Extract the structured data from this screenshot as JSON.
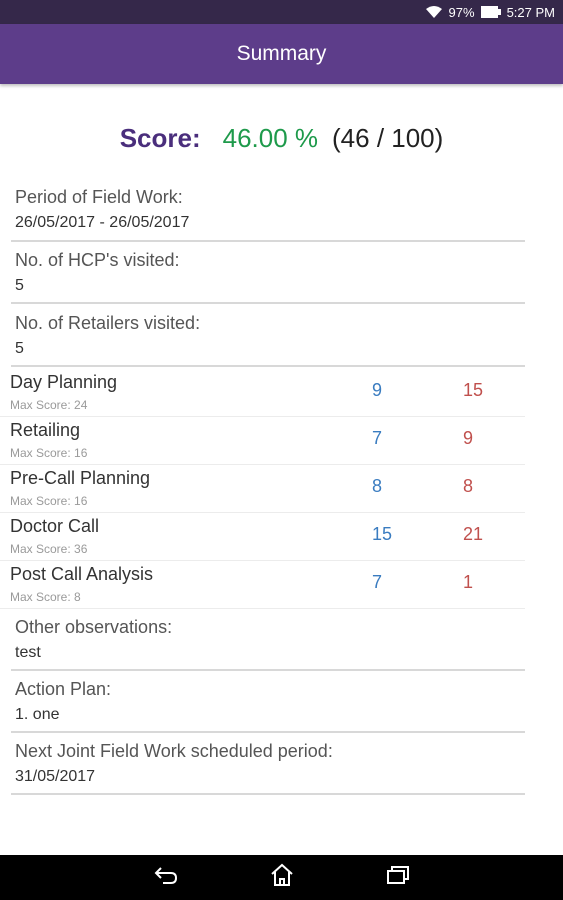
{
  "status_bar": {
    "battery_pct": "97%",
    "time": "5:27 PM",
    "icons": [
      "wifi-icon",
      "battery-icon"
    ]
  },
  "app_bar": {
    "title": "Summary"
  },
  "score": {
    "label": "Score:",
    "percent": "46.00 %",
    "ratio": "(46 / 100)"
  },
  "period": {
    "label": "Period of Field Work:",
    "value": "26/05/2017 - 26/05/2017"
  },
  "hcp": {
    "label": "No. of HCP's visited:",
    "value": "5"
  },
  "retailers": {
    "label": "No. of Retailers visited:",
    "value": "5"
  },
  "categories": [
    {
      "name": "Day Planning",
      "max": "Max Score: 24",
      "score": "9",
      "value": "15"
    },
    {
      "name": "Retailing",
      "max": "Max Score: 16",
      "score": "7",
      "value": "9"
    },
    {
      "name": "Pre-Call Planning",
      "max": "Max Score: 16",
      "score": "8",
      "value": "8"
    },
    {
      "name": "Doctor Call",
      "max": "Max Score: 36",
      "score": "15",
      "value": "21"
    },
    {
      "name": "Post Call Analysis",
      "max": "Max Score: 8",
      "score": "7",
      "value": "1"
    }
  ],
  "observations": {
    "label": "Other observations:",
    "value": "test"
  },
  "action_plan": {
    "label": "Action Plan:",
    "value": "1. one"
  },
  "next_period": {
    "label": "Next Joint Field Work scheduled period:",
    "value": "31/05/2017"
  },
  "nav_bar": {
    "icons": [
      "back-icon",
      "home-icon",
      "recent-apps-icon"
    ]
  },
  "colors": {
    "app_bar": "#5d3d8a",
    "score_label": "#4a2e7c",
    "score_percent": "#1e9a4b",
    "category_score": "#3a7cc0",
    "category_value": "#c0504d"
  }
}
